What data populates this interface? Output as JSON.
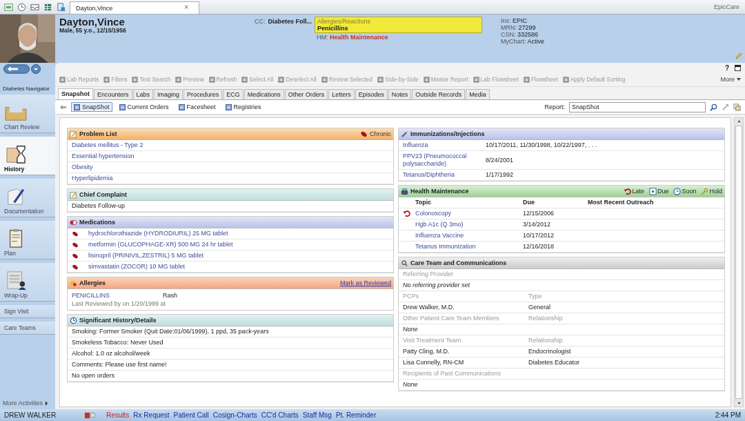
{
  "window": {
    "app_name": "EpicCare",
    "tabs": [
      {
        "label": "Dayton,Vince",
        "selected": true
      }
    ],
    "close": "×",
    "help": "?"
  },
  "patient": {
    "name": "Dayton,Vince",
    "details": "Male, 55 y.o., 12/15/1956",
    "cc_label": "CC:",
    "cc_value": "Diabetes Foll...",
    "allergy_label": "Allergies/Reactions",
    "allergy_value": "Penicillins",
    "hm_label": "HM:",
    "hm_value": "Health Maintenance",
    "info": [
      {
        "label": "Ins:",
        "value": "EPIC"
      },
      {
        "label": "MRN:",
        "value": "27299"
      },
      {
        "label": "CSN:",
        "value": "332586"
      },
      {
        "label": "MyChart:",
        "value": "Active"
      }
    ]
  },
  "sidebar": {
    "navigator": "Diabetes Navigator",
    "items": [
      {
        "label": "Chart Review",
        "kind": "icon",
        "selected": false
      },
      {
        "label": "History",
        "kind": "icon",
        "selected": true
      },
      {
        "label": "Documentation",
        "kind": "icon",
        "selected": false
      },
      {
        "label": "Plan",
        "kind": "icon",
        "selected": false
      },
      {
        "label": "Wrap-Up",
        "kind": "icon",
        "selected": false
      },
      {
        "label": "Sign Visit",
        "kind": "text",
        "selected": false
      },
      {
        "label": "Care Teams",
        "kind": "text",
        "selected": false
      }
    ],
    "more": "More Activities"
  },
  "toolbar": {
    "items": [
      "Lab Reports",
      "Filters",
      "Text Search",
      "Preview",
      "Refresh",
      "Select All",
      "Deselect All",
      "Review Selected",
      "Side-by-Side",
      "Master Report",
      "Lab Flowsheet",
      "Flowsheet",
      "Apply Default Sorting"
    ],
    "more": "More"
  },
  "tabs": [
    {
      "label": "Snapshot",
      "selected": true
    },
    {
      "label": "Encounters",
      "selected": false
    },
    {
      "label": "Labs",
      "selected": false
    },
    {
      "label": "Imaging",
      "selected": false
    },
    {
      "label": "Procedures",
      "selected": false
    },
    {
      "label": "ECG",
      "selected": false
    },
    {
      "label": "Medications",
      "selected": false
    },
    {
      "label": "Other Orders",
      "selected": false
    },
    {
      "label": "Letters",
      "selected": false
    },
    {
      "label": "Episodes",
      "selected": false
    },
    {
      "label": "Notes",
      "selected": false
    },
    {
      "label": "Outside Records",
      "selected": false
    },
    {
      "label": "Media",
      "selected": false
    }
  ],
  "subtabs": [
    {
      "label": "SnapShot",
      "selected": true
    },
    {
      "label": "Current Orders",
      "selected": false
    },
    {
      "label": "Facesheet",
      "selected": false
    },
    {
      "label": "Registries",
      "selected": false
    }
  ],
  "report": {
    "label": "Report:",
    "value": "SnapShot"
  },
  "problem_list": {
    "title": "Problem List",
    "chronic": "Chronic",
    "items": [
      "Diabetes mellitus - Type 2",
      "Essential hypertension",
      "Obesity",
      "Hyperlipidemia"
    ]
  },
  "chief_complaint": {
    "title": "Chief Complaint",
    "items": [
      "Diabetes Follow-up"
    ]
  },
  "medications": {
    "title": "Medications",
    "items": [
      "hydrochlorothiazide (HYDRODIURIL) 25 MG tablet",
      "metformin (GLUCOPHAGE-XR) 500 MG 24 hr tablet",
      "lisinopril (PRINIVIL,ZESTRIL) 5 MG tablet",
      "simvastatin (ZOCOR) 10 MG tablet"
    ]
  },
  "allergies": {
    "title": "Allergies",
    "action": "Mark as Reviewed",
    "items": [
      {
        "name": "PENICILLINS",
        "reaction": "Rash"
      }
    ],
    "note": "Last Reviewed by on 1/20/1999 at"
  },
  "history": {
    "title": "Significant History/Details",
    "items": [
      "Smoking: Former Smoker (Quit Date:01/06/1999), 1 ppd, 35 pack-years",
      "Smokeless Tobacco: Never Used",
      "Alcohol: 1.0 oz alcohol/week",
      "Comments: Please use first name!",
      "No open orders"
    ]
  },
  "immunizations": {
    "title": "Immunizations/Injections",
    "rows": [
      {
        "name": "Influenza",
        "dates": "10/17/2011, 11/30/1998, 10/22/1997, . . ."
      },
      {
        "name": "PPV23 (Pneumococcal polysaccharide)",
        "dates": "8/24/2001"
      },
      {
        "name": "Tetanus/Diphtheria",
        "dates": "1/17/1992"
      }
    ]
  },
  "health_maintenance": {
    "title": "Health Maintenance",
    "legend": [
      "Late",
      "Due",
      "Soon",
      "Hold"
    ],
    "columns": [
      "Topic",
      "Due",
      "Most Recent Outreach"
    ],
    "rows": [
      {
        "topic": "Colonoscopy",
        "due": "12/15/2006",
        "late": true
      },
      {
        "topic": "Hgb A1c (Q 3mo)",
        "due": "3/14/2012",
        "late": false
      },
      {
        "topic": "Influenza Vaccine",
        "due": "10/17/2012",
        "late": false
      },
      {
        "topic": "Tetanus Immunization",
        "due": "12/16/2018",
        "late": false
      }
    ]
  },
  "care_team": {
    "title": "Care Team and Communications",
    "groups": [
      {
        "headers": [
          "Referring Provider"
        ],
        "rows": [
          {
            "kind": "empty",
            "cells": [
              "No referring provider set"
            ]
          }
        ]
      },
      {
        "headers": [
          "PCPs",
          "Type"
        ],
        "rows": [
          {
            "kind": "entry",
            "cells": [
              "Drew Walker, M.D.",
              "General"
            ]
          }
        ]
      },
      {
        "headers": [
          "Other Patient Care Team Members",
          "Relationship"
        ],
        "rows": [
          {
            "kind": "empty",
            "cells": [
              "None"
            ]
          }
        ]
      },
      {
        "headers": [
          "Visit Treatment Team",
          "Relationship"
        ],
        "rows": [
          {
            "kind": "entry",
            "cells": [
              "Patty Cling, M.D.",
              "Endocrinologist"
            ]
          },
          {
            "kind": "entry",
            "cells": [
              "Lisa Connelly, RN-CM",
              "Diabetes Educator"
            ]
          }
        ]
      },
      {
        "headers": [
          "Recipients of Past Communications"
        ],
        "rows": [
          {
            "kind": "empty",
            "cells": [
              "None"
            ]
          }
        ]
      }
    ]
  },
  "status_bar": {
    "user": "DREW WALKER",
    "links": [
      {
        "label": "Results",
        "alert": true
      },
      {
        "label": "Rx Request",
        "alert": false
      },
      {
        "label": "Patient Call",
        "alert": false
      },
      {
        "label": "Cosign-Charts",
        "alert": false
      },
      {
        "label": "CC'd Charts",
        "alert": false
      },
      {
        "label": "Staff Msg",
        "alert": false
      },
      {
        "label": "Pt. Reminder",
        "alert": false
      }
    ],
    "time": "2:44 PM"
  }
}
